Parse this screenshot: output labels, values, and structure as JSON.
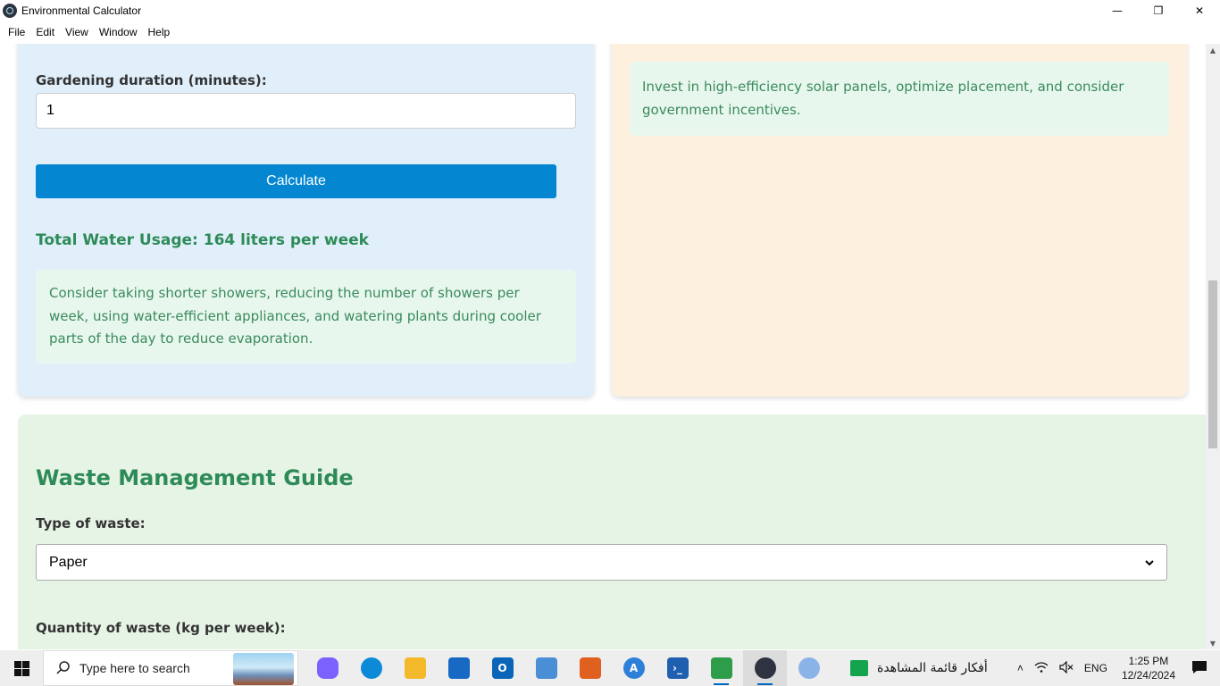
{
  "window": {
    "title": "Environmental Calculator",
    "controls": {
      "minimize": "—",
      "restore": "❐",
      "close": "✕"
    }
  },
  "menu": [
    "File",
    "Edit",
    "View",
    "Window",
    "Help"
  ],
  "water_card": {
    "gardening_label": "Gardening duration (minutes):",
    "gardening_value": "1",
    "calculate_label": "Calculate",
    "result": "Total Water Usage: 164 liters per week",
    "tip": "Consider taking shorter showers, reducing the number of showers per week, using water-efficient appliances, and watering plants during cooler parts of the day to reduce evaporation."
  },
  "energy_card": {
    "tip": "Invest in high-efficiency solar panels, optimize placement, and consider government incentives."
  },
  "waste_card": {
    "title": "Waste Management Guide",
    "type_label": "Type of waste:",
    "type_value": "Paper",
    "quantity_label": "Quantity of waste (kg per week):"
  },
  "taskbar": {
    "search_placeholder": "Type here to search",
    "widget_text": "أفكار قائمة المشاهدة",
    "language": "ENG",
    "time": "1:25 PM",
    "date": "12/24/2024",
    "apps": [
      {
        "name": "copilot",
        "color": "#7b61ff"
      },
      {
        "name": "edge",
        "color": "#0c8ad8"
      },
      {
        "name": "file-explorer",
        "color": "#f3b92b"
      },
      {
        "name": "microsoft-store",
        "color": "#1769c4"
      },
      {
        "name": "outlook",
        "color": "#0a64b8"
      },
      {
        "name": "laptop",
        "color": "#4a8fd6"
      },
      {
        "name": "matlab",
        "color": "#e0601f"
      },
      {
        "name": "app-a",
        "color": "#2d7fd8"
      },
      {
        "name": "powershell",
        "color": "#1f5fb0"
      },
      {
        "name": "chart-editor",
        "color": "#2e9d4a"
      },
      {
        "name": "electron",
        "color": "#2f3241"
      },
      {
        "name": "paint",
        "color": "#8ab4e8"
      }
    ]
  }
}
